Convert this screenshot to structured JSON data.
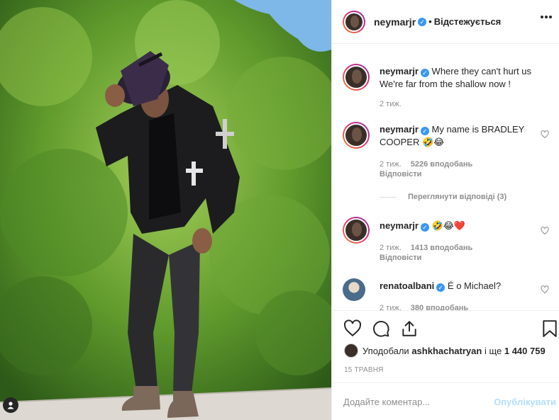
{
  "header": {
    "username": "neymarjr",
    "separator": "•",
    "follow_status": "Відстежується",
    "more_icon": "more-horizontal-icon"
  },
  "comments": [
    {
      "username": "neymarjr",
      "text": "Where they can't hurt us We're far from the shallow now !",
      "time": "2 тиж."
    },
    {
      "username": "neymarjr",
      "text": "My name is BRADLEY COOPER 🤣😂",
      "time": "2 тиж.",
      "likes": "5226 вподобань",
      "reply": "Відповісти"
    },
    {
      "view_replies": "Переглянути відповіді (3)"
    },
    {
      "username": "neymarjr",
      "text": "🤣😂❤️",
      "time": "2 тиж.",
      "likes": "1413 вподобань",
      "reply": "Відповісти"
    },
    {
      "username": "renatoalbani",
      "text": "É o Michael?",
      "time": "2 тиж.",
      "likes": "380 вподобань"
    }
  ],
  "liked_by": {
    "prefix": "Уподобали",
    "user": "ashkhachatryan",
    "connector": "і ще",
    "count": "1 440 759"
  },
  "date": "15 ТРАВНЯ",
  "add_comment": {
    "placeholder": "Додайте коментар...",
    "publish_label": "Опублікувати"
  },
  "colors": {
    "verified": "#3897f0",
    "publish_disabled": "#b2dffc",
    "muted": "#8e8e8e"
  }
}
